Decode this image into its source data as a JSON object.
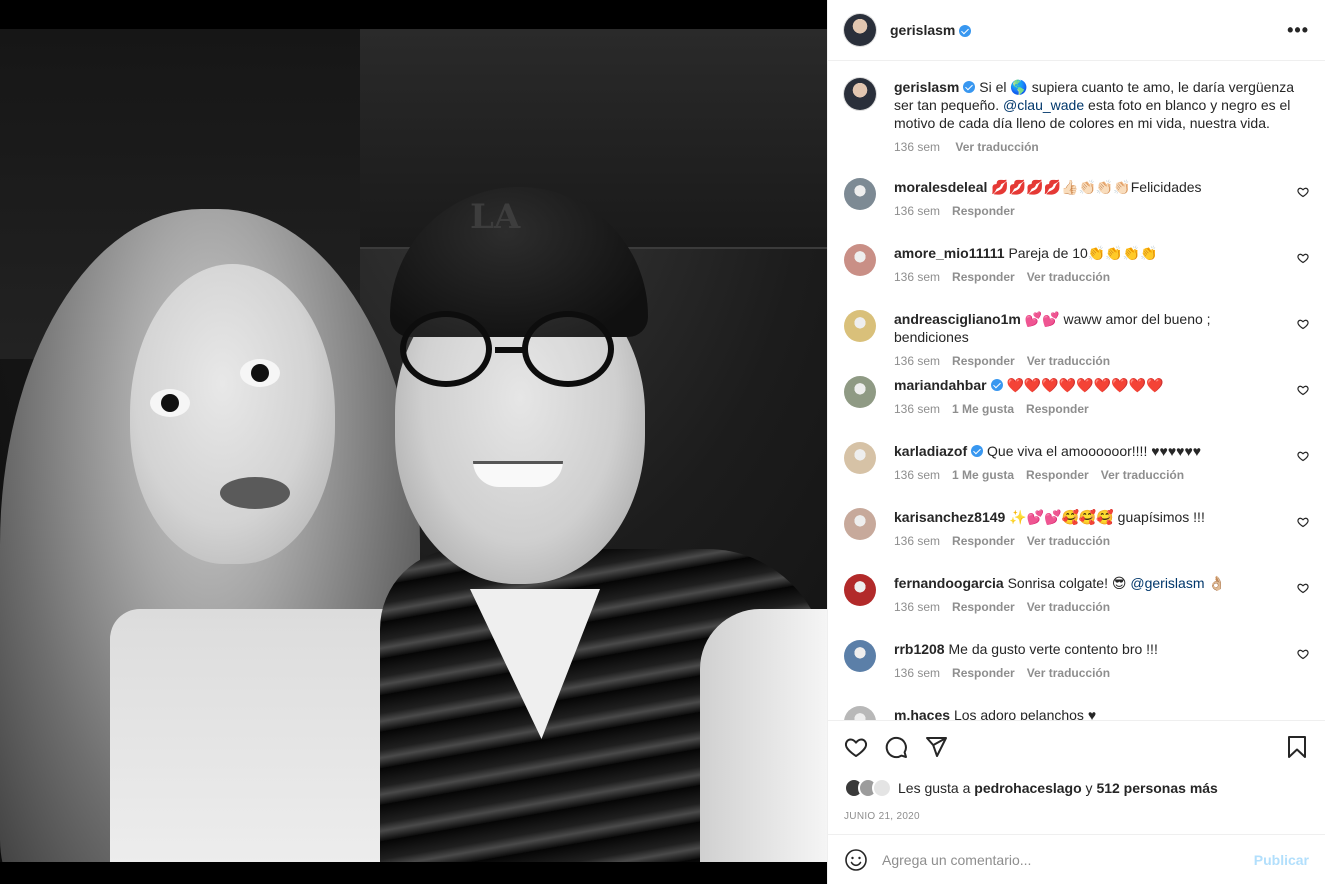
{
  "header": {
    "username": "gerislasm",
    "more_label": "•••"
  },
  "caption": {
    "username": "gerislasm",
    "text_before_emoji": "Si el",
    "emoji": "🌎",
    "text_mid": "supiera cuanto te amo, le daría vergüenza ser tan pequeño.",
    "mention": "@clau_wade",
    "text_after": "esta foto en blanco y negro es el motivo de cada día lleno de colores en mi vida, nuestra vida.",
    "time": "136 sem",
    "translate": "Ver traducción"
  },
  "comments": [
    {
      "username": "moralesdeleal",
      "text": "💋💋💋💋👍🏻👏🏻👏🏻👏🏻Felicidades",
      "time": "136 sem",
      "likes": "",
      "reply": "Responder",
      "translate": "",
      "verified": false,
      "avatar_color": "#7d8a94"
    },
    {
      "username": "amore_mio11111",
      "text": "Pareja de 10👏👏👏👏",
      "time": "136 sem",
      "likes": "",
      "reply": "Responder",
      "translate": "Ver traducción",
      "verified": false,
      "avatar_color": "#c98f86"
    },
    {
      "username": "andreascigliano1m",
      "text": "💕💕 waww amor del bueno ; bendiciones",
      "time": "136 sem",
      "likes": "",
      "reply": "Responder",
      "translate": "Ver traducción",
      "verified": false,
      "avatar_color": "#d9c07a"
    },
    {
      "username": "mariandahbar",
      "text": "❤️❤️❤️❤️❤️❤️❤️❤️❤️",
      "time": "136 sem",
      "likes": "1 Me gusta",
      "reply": "Responder",
      "translate": "",
      "verified": true,
      "avatar_color": "#8f9a84"
    },
    {
      "username": "karladiazof",
      "text": "Que viva el amoooooor!!!! ♥♥♥♥♥♥",
      "time": "136 sem",
      "likes": "1 Me gusta",
      "reply": "Responder",
      "translate": "Ver traducción",
      "verified": true,
      "avatar_color": "#d6c2a6"
    },
    {
      "username": "karisanchez8149",
      "text": "✨💕💕🥰🥰🥰 guapísimos !!!",
      "time": "136 sem",
      "likes": "",
      "reply": "Responder",
      "translate": "Ver traducción",
      "verified": false,
      "avatar_color": "#c7a99b"
    },
    {
      "username": "fernandoogarcia",
      "text": "Sonrisa colgate! 😎 ",
      "mention": "@gerislasm",
      "suffix": " 👌🏼",
      "time": "136 sem",
      "likes": "",
      "reply": "Responder",
      "translate": "Ver traducción",
      "verified": false,
      "avatar_color": "#b22a2a"
    },
    {
      "username": "rrb1208",
      "text": "Me da gusto verte contento bro !!!",
      "time": "136 sem",
      "likes": "",
      "reply": "Responder",
      "translate": "Ver traducción",
      "verified": false,
      "avatar_color": "#5b7fa8"
    },
    {
      "username": "m.haces",
      "text": "Los adoro pelanchos ♥",
      "time": "",
      "likes": "",
      "reply": "",
      "translate": "",
      "verified": false,
      "avatar_color": "#b8b8b8"
    }
  ],
  "likes": {
    "prefix": "Les gusta a",
    "user": "pedrohaceslago",
    "conj": "y",
    "count": "512 personas más"
  },
  "date": "JUNIO 21, 2020",
  "add_comment": {
    "placeholder": "Agrega un comentario...",
    "publish": "Publicar"
  },
  "photo": {
    "cap_logo": "LA"
  }
}
